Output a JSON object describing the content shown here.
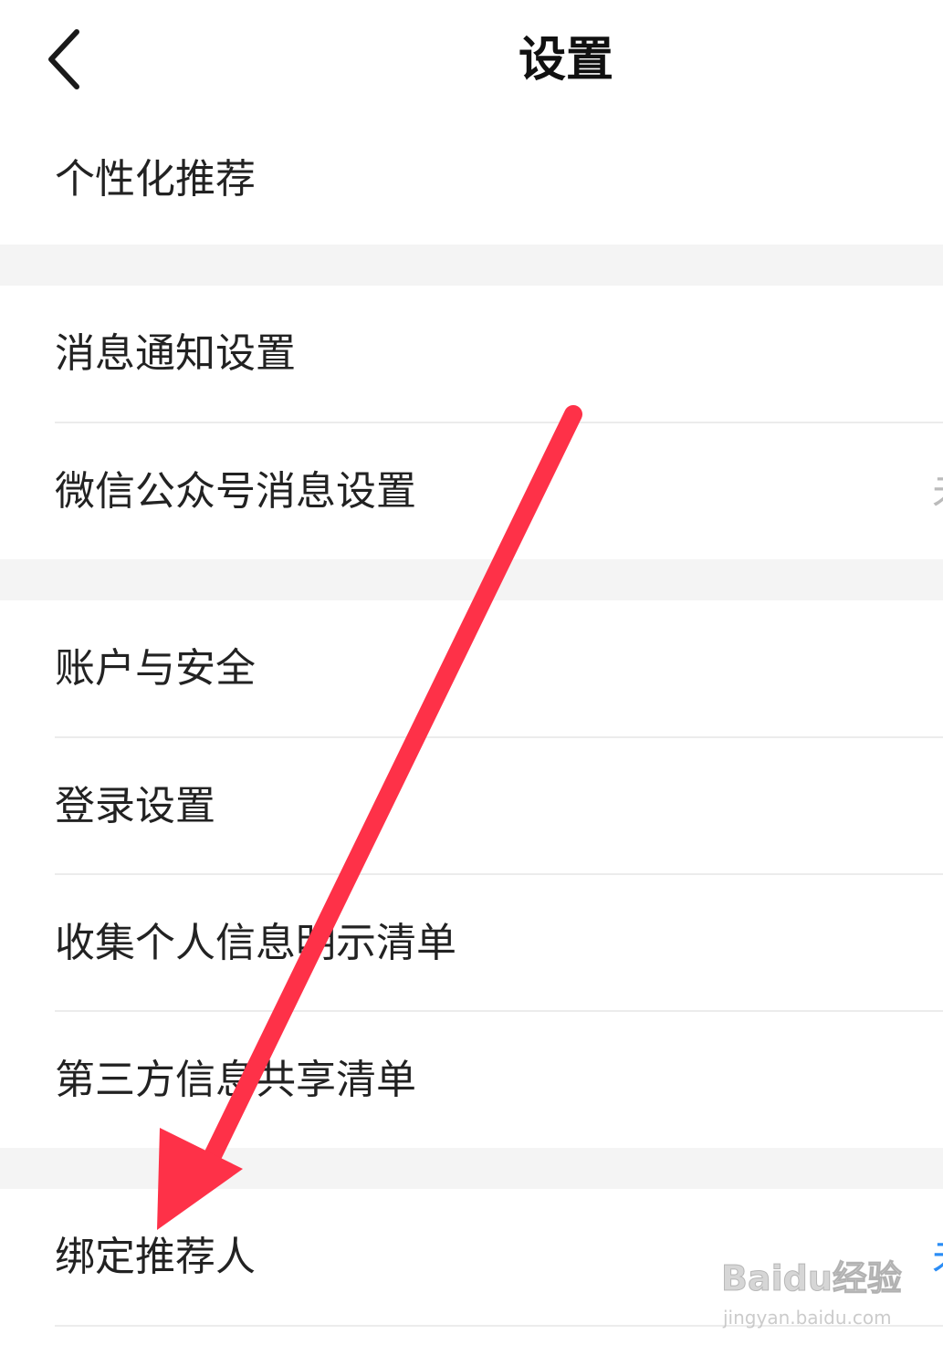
{
  "header": {
    "title": "设置"
  },
  "rows": [
    {
      "label": "个性化推荐",
      "value": ""
    },
    {
      "label": "消息通知设置",
      "value": ""
    },
    {
      "label": "微信公众号消息设置",
      "value": "未"
    },
    {
      "label": "账户与安全",
      "value": ""
    },
    {
      "label": "登录设置",
      "value": ""
    },
    {
      "label": "收集个人信息明示清单",
      "value": ""
    },
    {
      "label": "第三方信息共享清单",
      "value": ""
    },
    {
      "label": "绑定推荐人",
      "value": "未"
    }
  ],
  "colors": {
    "background": "#ffffff",
    "section_gap": "#f4f4f4",
    "divider": "#ececec",
    "text": "#222222",
    "muted_value": "#bbbbbb",
    "accent_value": "#2b8df5",
    "annotation_arrow": "#fe3148"
  },
  "icons": {
    "back": "chevron-left-icon",
    "annotation": "red-arrow-annotation"
  },
  "watermark": {
    "brand": "Baidu经验",
    "url": "jingyan.baidu.com"
  }
}
